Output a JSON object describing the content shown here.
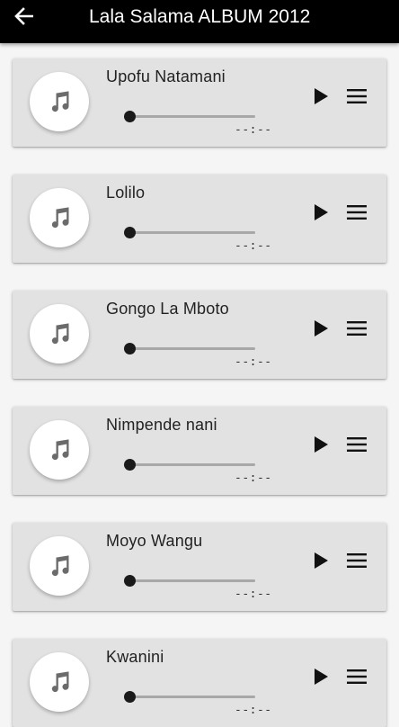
{
  "appbar": {
    "title": "Lala Salama ALBUM 2012",
    "back_icon": "arrow-left-icon",
    "background": "#000000"
  },
  "songs": [
    {
      "title": "Upofu Natamani",
      "time": "--:--",
      "progress": 0
    },
    {
      "title": "Lolilo",
      "time": "--:--",
      "progress": 0
    },
    {
      "title": "Gongo La Mboto",
      "time": "--:--",
      "progress": 0
    },
    {
      "title": "Nimpende nani",
      "time": "--:--",
      "progress": 0
    },
    {
      "title": "Moyo Wangu",
      "time": "--:--",
      "progress": 0
    },
    {
      "title": "Kwanini",
      "time": "--:--",
      "progress": 0
    }
  ],
  "icons": {
    "art": "music-note-icon",
    "play": "play-icon",
    "menu": "menu-icon"
  },
  "colors": {
    "card": "#e2e2e2",
    "page": "#f5f5f5",
    "seek_track": "#a8a8a8",
    "seek_thumb": "#1a1a1a"
  }
}
